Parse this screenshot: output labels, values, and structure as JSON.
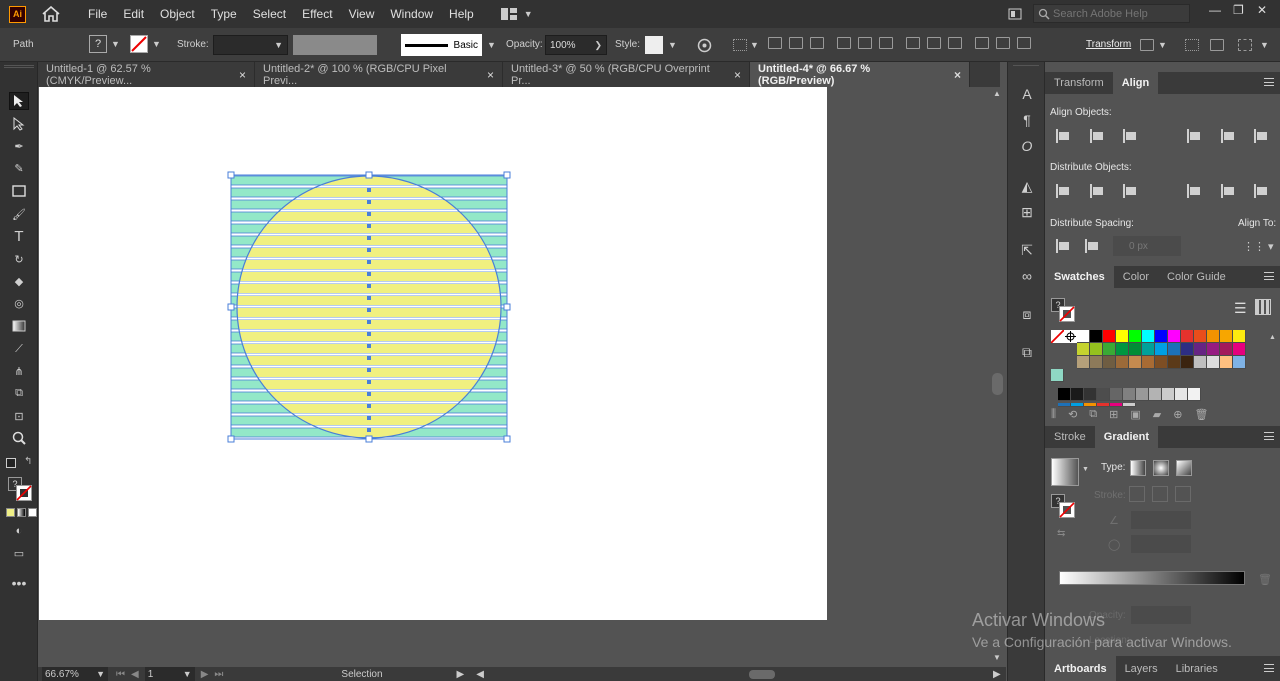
{
  "app": {
    "logo": "Ai"
  },
  "menu": [
    "File",
    "Edit",
    "Object",
    "Type",
    "Select",
    "Effect",
    "View",
    "Window",
    "Help"
  ],
  "search": {
    "placeholder": "Search Adobe Help"
  },
  "control": {
    "selection_type": "Path",
    "stroke_label": "Stroke:",
    "brush_label": "Basic",
    "opacity_label": "Opacity:",
    "opacity_value": "100%",
    "style_label": "Style:",
    "transform_label": "Transform"
  },
  "tabs": [
    {
      "label": "Untitled-1 @ 62.57 % (CMYK/Preview...",
      "close": "×"
    },
    {
      "label": "Untitled-2* @ 100 % (RGB/CPU Pixel Previ...",
      "close": "×"
    },
    {
      "label": "Untitled-3* @ 50 % (RGB/CPU Overprint Pr...",
      "close": "×"
    },
    {
      "label": "Untitled-4* @ 66.67 % (RGB/Preview)",
      "close": "×"
    }
  ],
  "status": {
    "zoom": "66.67%",
    "artboard_num": "1",
    "tool": "Selection"
  },
  "align_panel": {
    "tabs": [
      "Transform",
      "Align"
    ],
    "align_objects": "Align Objects:",
    "distribute_objects": "Distribute Objects:",
    "distribute_spacing": "Distribute Spacing:",
    "align_to": "Align To:",
    "spacing_value": "0 px"
  },
  "swatches_panel": {
    "tabs": [
      "Swatches",
      "Color",
      "Color Guide"
    ],
    "rows": [
      [
        "#ffffff",
        "#000000",
        "#ff0000",
        "#ffff00",
        "#00ff00",
        "#00ffff",
        "#0000ff",
        "#ff00ff",
        "#e5322d",
        "#e94e1b",
        "#f39200",
        "#f7a600",
        "#fcea10"
      ],
      [
        "#c5d32f",
        "#95c11f",
        "#3aaa35",
        "#009640",
        "#008d36",
        "#00a19a",
        "#009fe3",
        "#1d71b8",
        "#2d2e83",
        "#662483",
        "#951b81",
        "#a3195b",
        "#e6007e"
      ],
      [
        "#b5a07a",
        "#8d7a5a",
        "#6f5d42",
        "#9b6a39",
        "#c48a4f",
        "#a86b34",
        "#7d4e24",
        "#5b3a19",
        "#3b2410",
        "#bfbfbf",
        "#dddddd",
        "#ffc080",
        "#7fb2e5"
      ],
      [
        "#8fd8c4"
      ],
      [
        "#000000",
        "#1a1a1a",
        "#333333",
        "#4d4d4d",
        "#666666",
        "#808080",
        "#999999",
        "#b3b3b3",
        "#cccccc",
        "#e6e6e6",
        "#f2f2f2"
      ],
      [
        "#1d71b8",
        "#009fe3",
        "#f39200",
        "#e5322d",
        "#e6007e",
        "#cccccc"
      ]
    ]
  },
  "gradient_panel": {
    "tabs": [
      "Stroke",
      "Gradient"
    ],
    "type_label": "Type:",
    "stroke_label": "Stroke:",
    "opacity_label": "Opacity:",
    "location_label": "Location:"
  },
  "bottom_panel": {
    "tabs": [
      "Artboards",
      "Layers",
      "Libraries"
    ]
  },
  "watermark": {
    "line1": "Activar Windows",
    "line2": "Ve a Configuración para activar Windows."
  },
  "artwork": {
    "stripe_colors": [
      "#93e8c8",
      "#f0f080"
    ],
    "stripe_count": 22,
    "circle_fill": "#efef86",
    "selection_color": "#4a7fd8"
  }
}
